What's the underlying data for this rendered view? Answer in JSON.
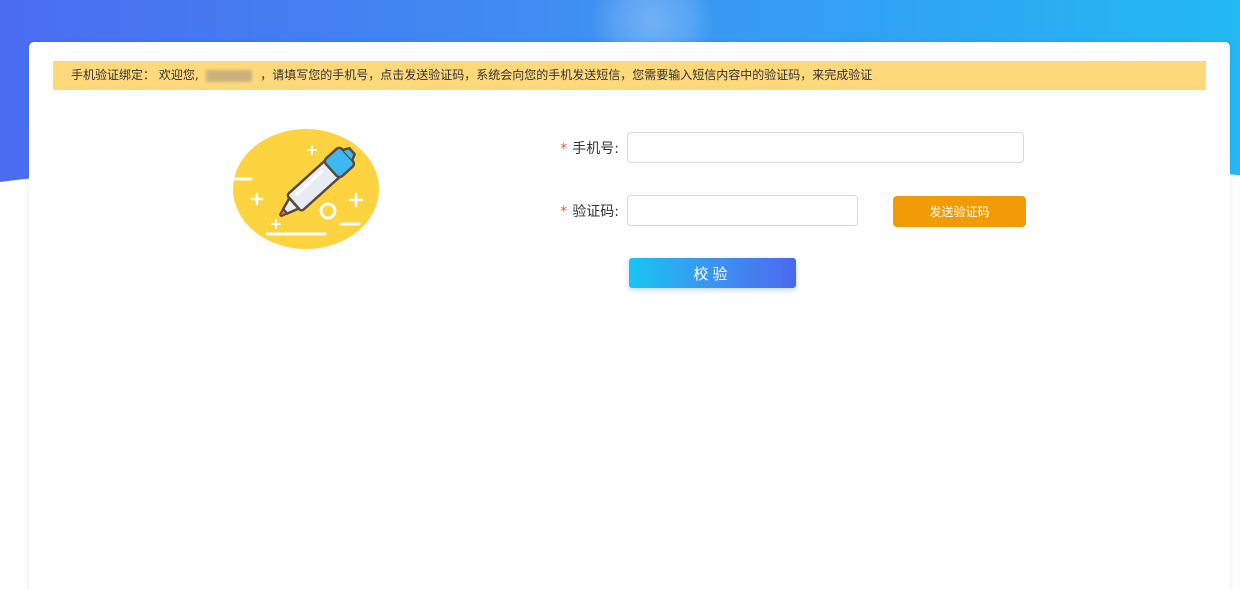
{
  "notice": {
    "prefix": "手机验证绑定： 欢迎您,",
    "suffix": "，请填写您的手机号，点击发送验证码，系统会向您的手机发送短信，您需要输入短信内容中的验证码，来完成验证"
  },
  "form": {
    "required_mark": "*",
    "phone_label": "手机号:",
    "phone_value": "",
    "code_label": "验证码:",
    "code_value": "",
    "send_code_label": "发送验证码",
    "verify_label": "校验"
  },
  "colors": {
    "notice_bg": "#fed97b",
    "send_button": "#f19c06",
    "verify_gradient_start": "#18c4f3",
    "verify_gradient_end": "#4a68ee",
    "required": "#e05b4b"
  },
  "icons": {
    "illustration": "highlighter-pen-icon"
  }
}
